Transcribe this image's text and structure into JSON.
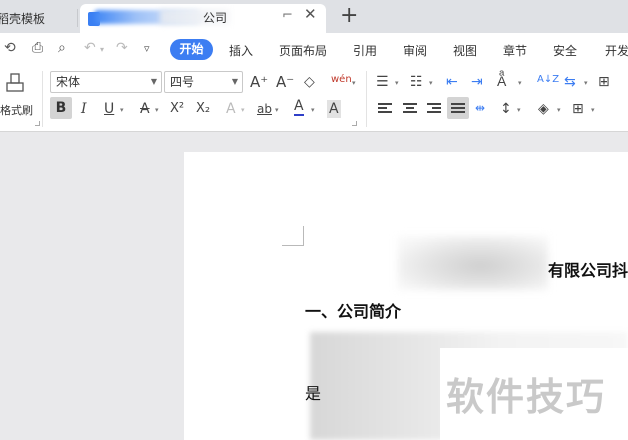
{
  "tabs": {
    "previous_tab_label": "稻壳模板",
    "active_tab_label": "公司",
    "new_tab_symbol": "+"
  },
  "quick_access": {
    "icons": [
      "redo-icon",
      "print-icon",
      "print-preview-icon",
      "undo-icon",
      "redo-arrow-icon",
      "more-icon"
    ]
  },
  "menu": {
    "active": "开始",
    "items": [
      "插入",
      "页面布局",
      "引用",
      "审阅",
      "视图",
      "章节",
      "安全",
      "开发"
    ]
  },
  "ribbon": {
    "format_painter_label": "格式刷",
    "font_name": "宋体",
    "font_size": "四号",
    "grow_font": "A⁺",
    "shrink_font": "A⁻",
    "phonetic": "wén",
    "bold": "B",
    "italic": "I",
    "underline": "U",
    "strike": "A",
    "superscript": "X²",
    "subscript": "X₂",
    "font_effect": "A",
    "highlight": "ab",
    "font_color": "A",
    "char_shading": "A",
    "sort": "A↓Z"
  },
  "document": {
    "title_visible": "有限公司",
    "title_cut_char": "抖",
    "section_heading": "一、公司简介",
    "body_start": "是"
  },
  "watermark": "软件技巧",
  "colors": {
    "accent": "#3c7df2",
    "font_color_underline": "#2f3fc8",
    "page_bg": "#ffffff",
    "workspace_bg": "#e9e9eb"
  }
}
